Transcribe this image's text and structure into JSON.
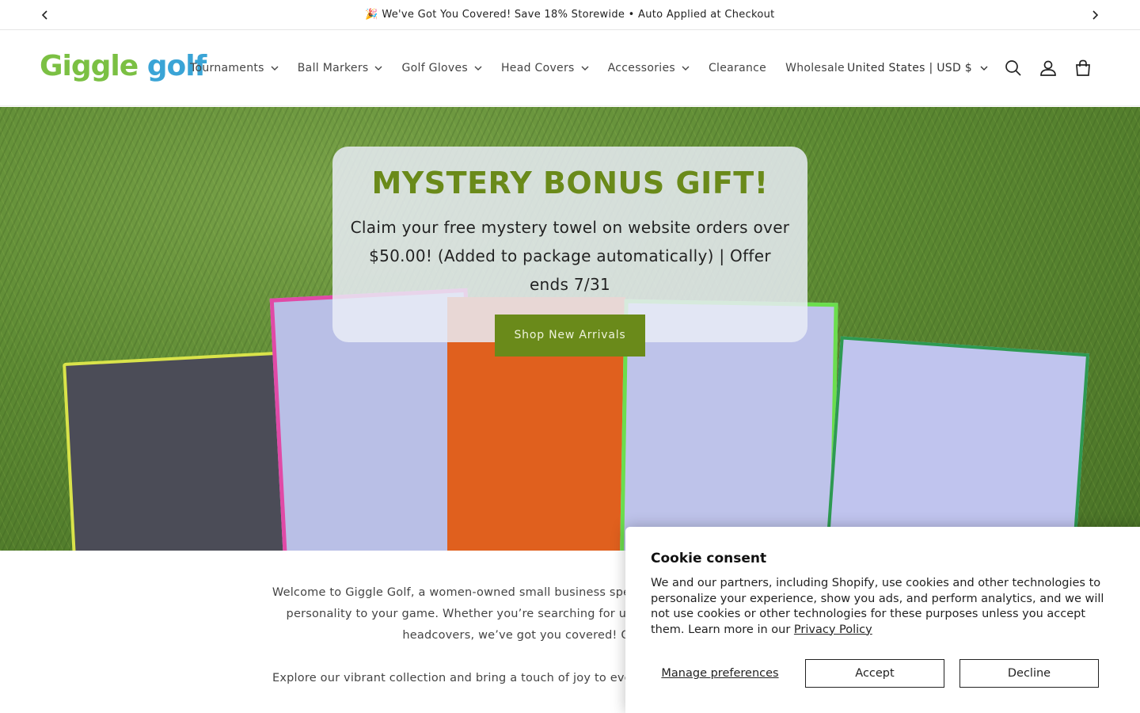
{
  "announcement": {
    "text": "🎉 We've Got You Covered! Save 18% Storewide • Auto Applied at Checkout",
    "prev_icon": "chevron-left-icon",
    "next_icon": "chevron-right-icon"
  },
  "header": {
    "logo_part1": "Giggle",
    "logo_part2": "golf",
    "nav": [
      {
        "label": "Tournaments",
        "dropdown": true
      },
      {
        "label": "Ball Markers",
        "dropdown": true
      },
      {
        "label": "Golf Gloves",
        "dropdown": true
      },
      {
        "label": "Head Covers",
        "dropdown": true
      },
      {
        "label": "Accessories",
        "dropdown": true
      },
      {
        "label": "Clearance",
        "dropdown": false
      },
      {
        "label": "Wholesale",
        "dropdown": false
      }
    ],
    "country_selector": "United States | USD $",
    "icons": [
      "search-icon",
      "account-icon",
      "cart-icon"
    ]
  },
  "hero": {
    "title": "MYSTERY BONUS GIFT!",
    "text": "Claim your free mystery towel on website orders over $50.00! (Added to package automatically) | Offer ends 7/31",
    "button": "Shop New Arrivals",
    "accent_color": "#6a8a1a"
  },
  "welcome": {
    "paragraph1": "Welcome to Giggle Golf, a women-owned small business specializing in fun golf accessories that add personality to your game. Whether you’re searching for unique golf ball markers, golf gloves, or headcovers, we’ve got you covered! Our accessories are",
    "paragraph2": "Explore our vibrant collection and bring a touch of joy to every round, giveaways, or the golf lover in"
  },
  "cookie": {
    "title": "Cookie consent",
    "text": "We and our partners, including Shopify, use cookies and other technologies to personalize your experience, show you ads, and perform analytics, and we will not use cookies or other technologies for these purposes unless you accept them. Learn more in our",
    "link": "Privacy Policy",
    "manage": "Manage preferences",
    "accept": "Accept",
    "decline": "Decline"
  }
}
